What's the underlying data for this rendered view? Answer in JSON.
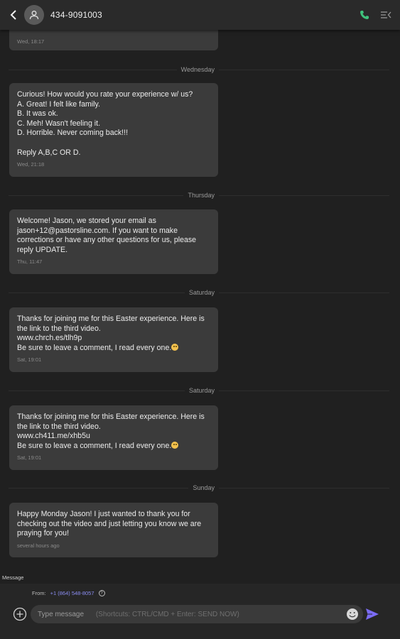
{
  "header": {
    "contact_name": "434-9091003",
    "icons": [
      "back-arrow-icon",
      "person-icon",
      "phone-icon",
      "menu-collapse-icon"
    ],
    "accent": "#3fc27c"
  },
  "conversation": {
    "partial_message_time": "Wed, 18:17",
    "items": [
      {
        "divider": "Wednesday",
        "text": "Curious! How would you rate your experience w/ us?\nA. Great! I felt like family.\nB. It was ok.\nC. Meh! Wasn't feeling it.\nD. Horrible. Never coming back!!!\n\nReply A,B,C OR D.",
        "time": "Wed, 21:18"
      },
      {
        "divider": "Thursday",
        "text": "Welcome! Jason, we stored your email as jason+12@pastorsline.com. If you want to make corrections or have any other questions for us, please reply UPDATE.",
        "time": "Thu, 11:47"
      },
      {
        "divider": "Saturday",
        "text": "Thanks for joining me for this Easter experience. Here is the link to the third video.\nwww.chrch.es/tlh9p\nBe sure to leave a comment, I read every one.",
        "time": "Sat, 19:01"
      },
      {
        "divider": "Saturday",
        "text": "Thanks for joining me for this Easter experience. Here is the link to the third video.\nwww.ch411.me/xhb5u\nBe sure to leave a comment, I read every one.",
        "time": "Sat, 19:01"
      },
      {
        "divider": "Sunday",
        "text": "Happy Monday Jason! I just wanted to thank you for checking out the video and just letting you know we are praying for you!",
        "time": "several hours ago"
      }
    ]
  },
  "composer": {
    "section_label": "Message",
    "from_label": "From:",
    "from_number": "+1 (864) 548-8057",
    "placeholder": "Type message",
    "shortcut_hint": "(Shortcuts: CTRL/CMD + Enter: SEND NOW)",
    "send_color": "#7b6cf6"
  }
}
